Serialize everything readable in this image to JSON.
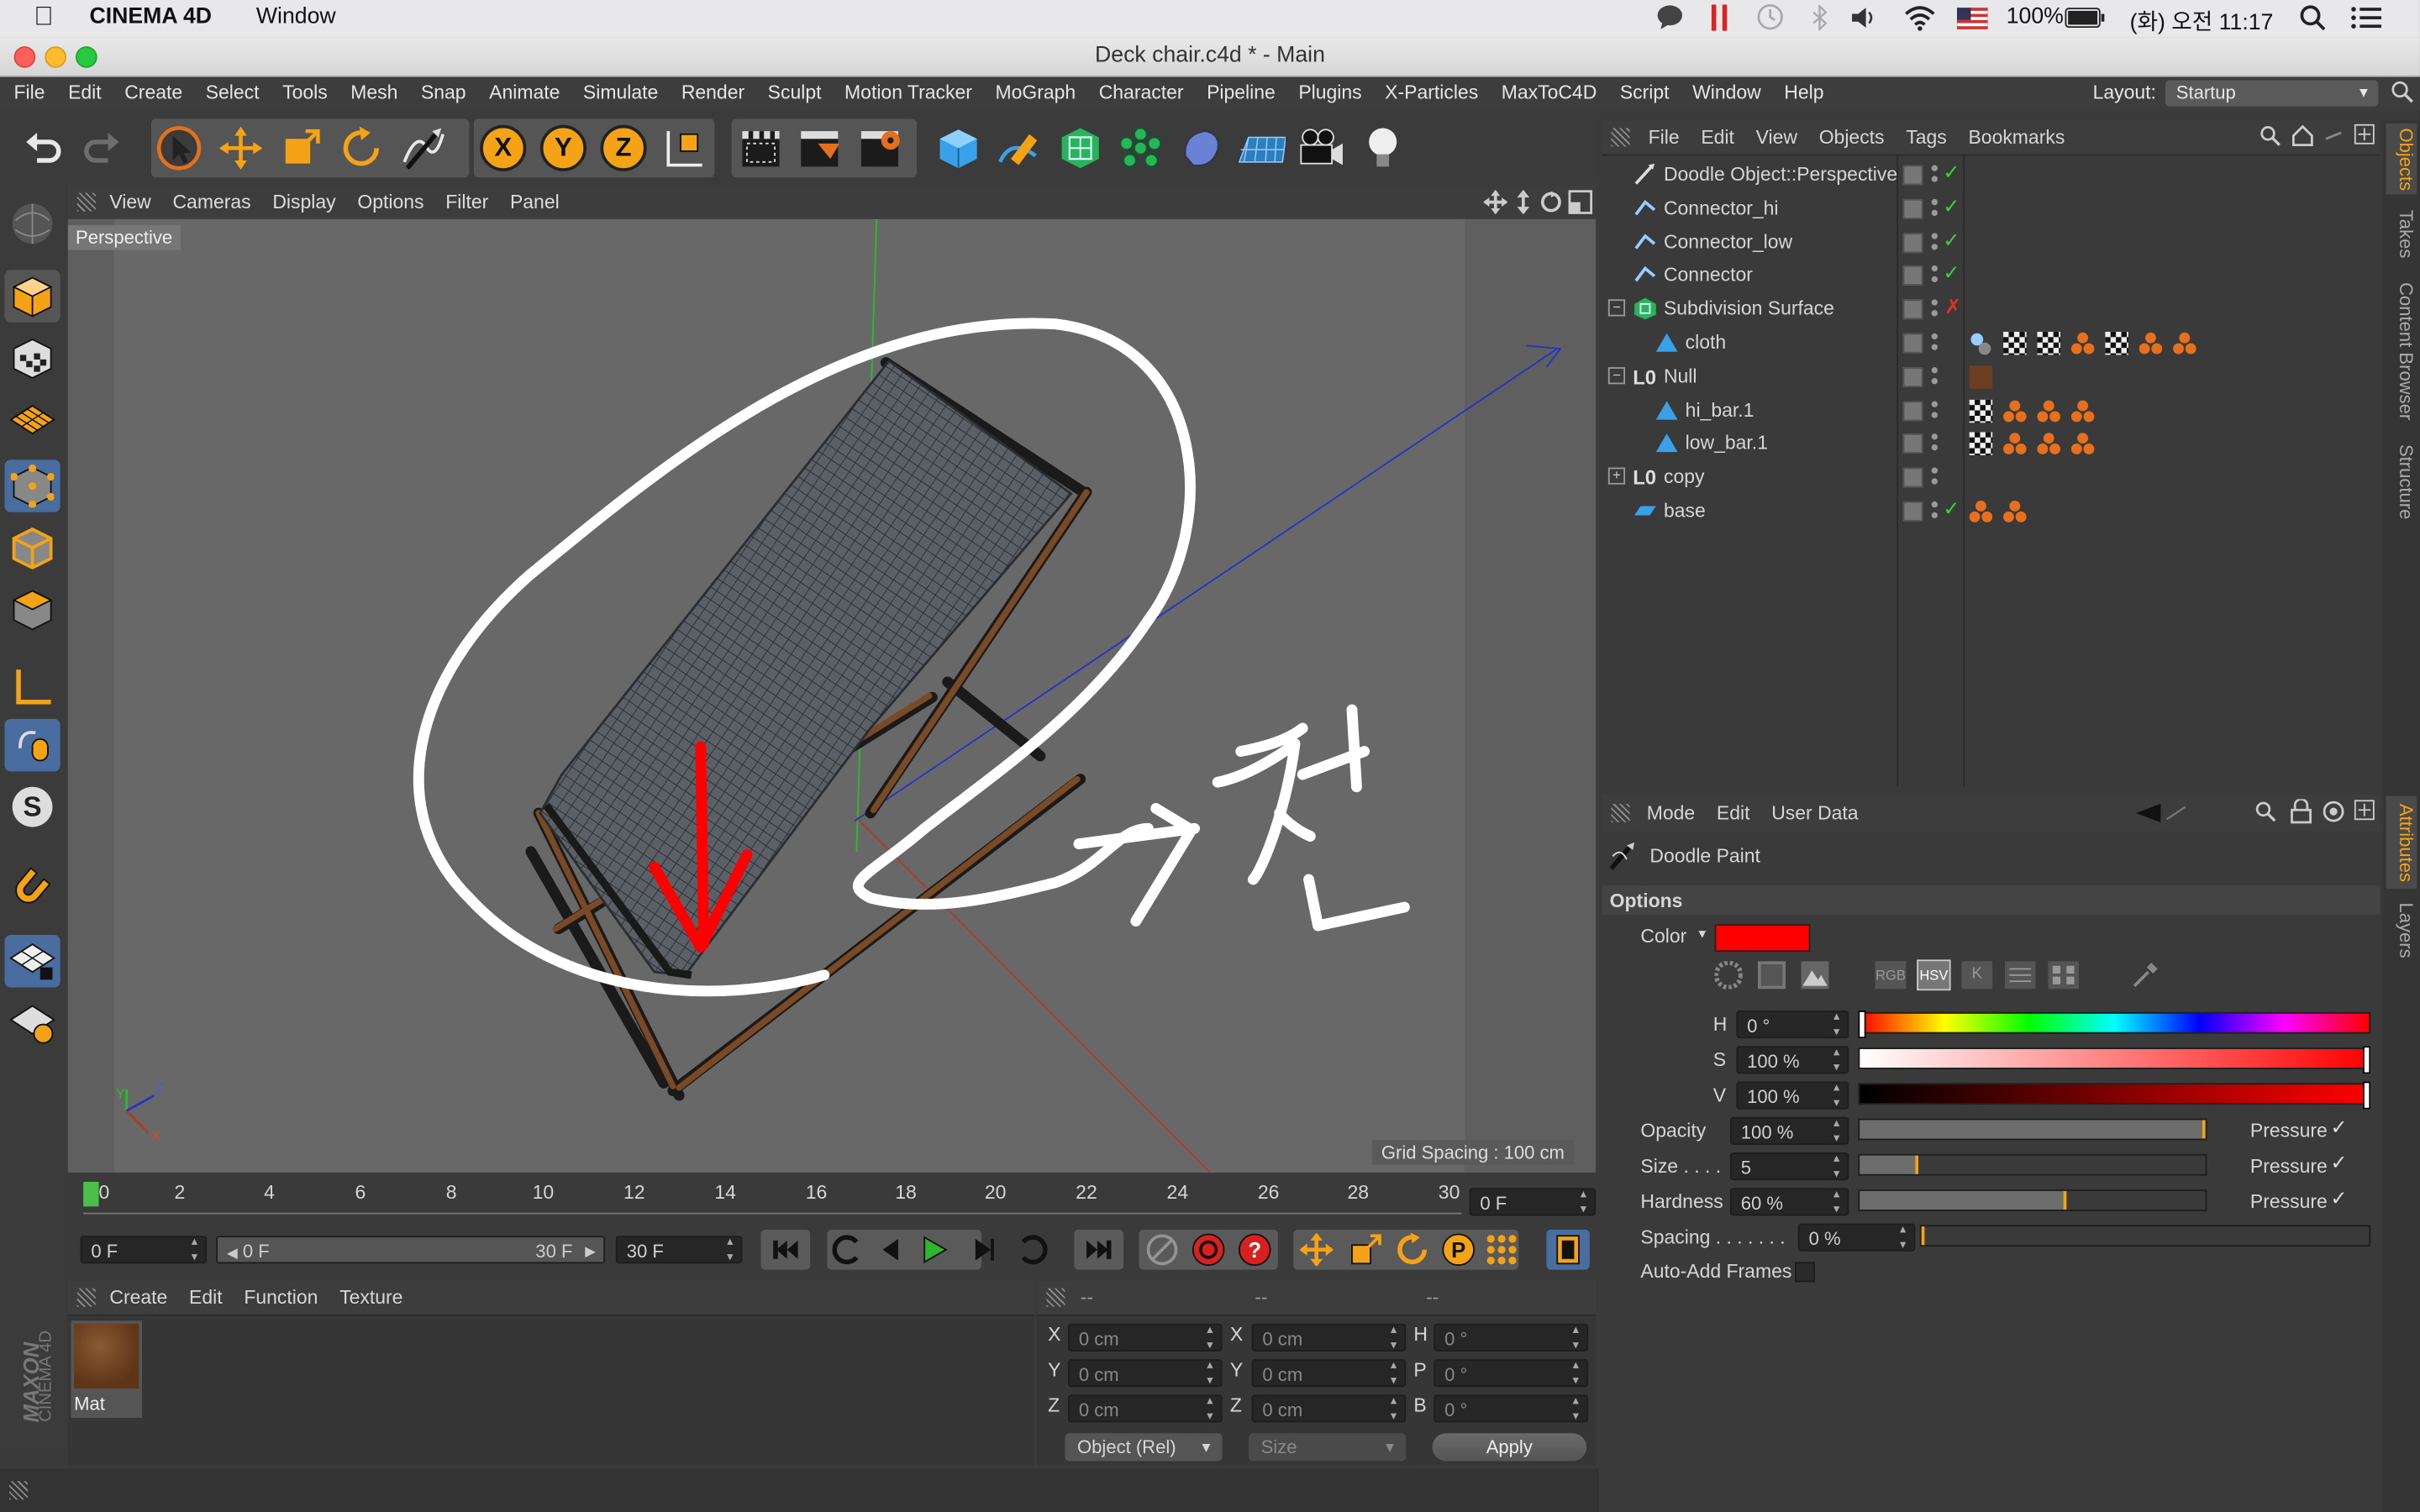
{
  "mac_menubar": {
    "app_name": "CINEMA 4D",
    "window_menu": "Window",
    "battery": "100%",
    "clock": "(화) 오전 11:17"
  },
  "window": {
    "title": "Deck chair.c4d * - Main"
  },
  "app_menu": {
    "items": [
      "File",
      "Edit",
      "Create",
      "Select",
      "Tools",
      "Mesh",
      "Snap",
      "Animate",
      "Simulate",
      "Render",
      "Sculpt",
      "Motion Tracker",
      "MoGraph",
      "Character",
      "Pipeline",
      "Plugins",
      "X-Particles",
      "MaxToC4D",
      "Script",
      "Window",
      "Help"
    ],
    "layout_label": "Layout:",
    "layout_value": "Startup"
  },
  "toolbar": {
    "axis_x": "X",
    "axis_y": "Y",
    "axis_z": "Z"
  },
  "viewport": {
    "menu": [
      "View",
      "Cameras",
      "Display",
      "Options",
      "Filter",
      "Panel"
    ],
    "camera_label": "Perspective",
    "grid_spacing": "Grid Spacing : 100 cm",
    "handwriting": "천",
    "axis_gizmo": {
      "x": "X",
      "y": "Y",
      "z": "Z"
    }
  },
  "timeline": {
    "ticks": [
      "0",
      "2",
      "4",
      "6",
      "8",
      "10",
      "12",
      "14",
      "16",
      "18",
      "20",
      "22",
      "24",
      "26",
      "28",
      "30"
    ],
    "current_frame_field": "0 F",
    "start_field": "0 F",
    "range_start": "0 F",
    "range_end": "30 F",
    "end_field": "30 F"
  },
  "material_manager": {
    "menu": [
      "Create",
      "Edit",
      "Function",
      "Texture"
    ],
    "material_name": "Mat",
    "material_color": "#6b3f22"
  },
  "coordinates": {
    "header": [
      "--",
      "--",
      "--"
    ],
    "rows": [
      {
        "l1": "X",
        "v1": "0 cm",
        "l2": "X",
        "v2": "0 cm",
        "l3": "H",
        "v3": "0 °"
      },
      {
        "l1": "Y",
        "v1": "0 cm",
        "l2": "Y",
        "v2": "0 cm",
        "l3": "P",
        "v3": "0 °"
      },
      {
        "l1": "Z",
        "v1": "0 cm",
        "l2": "Z",
        "v2": "0 cm",
        "l3": "B",
        "v3": "0 °"
      }
    ],
    "mode_select": "Object (Rel)",
    "size_select": "Size",
    "apply_label": "Apply"
  },
  "object_manager": {
    "menu": [
      "File",
      "Edit",
      "View",
      "Objects",
      "Tags",
      "Bookmarks"
    ],
    "objects": [
      {
        "name": "Doodle Object::Perspective",
        "indent": 0,
        "expand": "",
        "icon": "doodle-icon",
        "status": "check"
      },
      {
        "name": "Connector_hi",
        "indent": 0,
        "expand": "",
        "icon": "connector-icon",
        "status": "check"
      },
      {
        "name": "Connector_low",
        "indent": 0,
        "expand": "",
        "icon": "connector-icon",
        "status": "check"
      },
      {
        "name": "Connector",
        "indent": 0,
        "expand": "",
        "icon": "connector-icon",
        "status": "check"
      },
      {
        "name": "Subdivision Surface",
        "indent": 0,
        "expand": "−",
        "icon": "subdivision-icon",
        "status": "cross"
      },
      {
        "name": "cloth",
        "indent": 1,
        "expand": "",
        "icon": "polygon-icon",
        "status": ""
      },
      {
        "name": "Null",
        "indent": 0,
        "expand": "−",
        "icon": "null-icon",
        "status": ""
      },
      {
        "name": "hi_bar.1",
        "indent": 1,
        "expand": "",
        "icon": "polygon-icon",
        "status": ""
      },
      {
        "name": "low_bar.1",
        "indent": 1,
        "expand": "",
        "icon": "polygon-icon",
        "status": ""
      },
      {
        "name": "copy",
        "indent": 0,
        "expand": "+",
        "icon": "null-icon",
        "status": ""
      },
      {
        "name": "base",
        "indent": 0,
        "expand": "",
        "icon": "plane-icon",
        "status": "check"
      }
    ]
  },
  "attributes": {
    "menu": [
      "Mode",
      "Edit",
      "User Data"
    ],
    "object_label": "Doodle Paint",
    "section": "Options",
    "color_label": "Color",
    "color_value": "#ff0000",
    "color_modes": [
      "RGB",
      "HSV",
      "K"
    ],
    "h": {
      "label": "H",
      "value": "0 °"
    },
    "s": {
      "label": "S",
      "value": "100 %"
    },
    "v": {
      "label": "V",
      "value": "100 %"
    },
    "opacity": {
      "label": "Opacity",
      "value": "100 %",
      "level": 1.0,
      "pressure": "Pressure"
    },
    "size": {
      "label": "Size . . . .",
      "value": "5",
      "level": 0.17,
      "pressure": "Pressure"
    },
    "hardness": {
      "label": "Hardness",
      "value": "60 %",
      "level": 0.6,
      "pressure": "Pressure"
    },
    "spacing": {
      "label": "Spacing . . . . . . .",
      "value": "0 %",
      "level": 0.0
    },
    "auto_add": {
      "label": "Auto-Add Frames"
    }
  },
  "right_tabs": [
    "Objects",
    "Takes",
    "Content Browser",
    "Structure",
    "Attributes",
    "Layers"
  ],
  "left_logo": {
    "line1": "MAXON",
    "line2": "CINEMA 4D"
  }
}
